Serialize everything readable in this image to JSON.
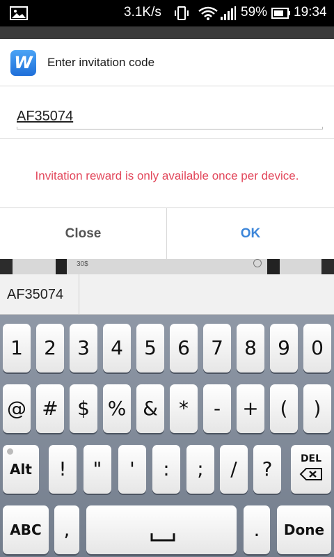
{
  "status_bar": {
    "speed": "3.1K/s",
    "battery_pct": "59%",
    "time": "19:34",
    "icons": [
      "image-icon",
      "vibrate-icon",
      "wifi-icon",
      "signal-icon",
      "battery-icon"
    ]
  },
  "background": {
    "price": "30$"
  },
  "dialog": {
    "title": "Enter invitation code",
    "app_logo_letter": "W",
    "code_value": "AF35074",
    "message": "Invitation reward is only available once per device.",
    "close_label": "Close",
    "ok_label": "OK"
  },
  "suggestion": {
    "word": "AF35074"
  },
  "keyboard": {
    "row1": [
      "1",
      "2",
      "3",
      "4",
      "5",
      "6",
      "7",
      "8",
      "9",
      "0"
    ],
    "row2": [
      "@",
      "#",
      "$",
      "%",
      "&",
      "*",
      "-",
      "+",
      "(",
      ")"
    ],
    "alt_label": "Alt",
    "row3": [
      "!",
      "\"",
      "'",
      ":",
      ";",
      "/",
      "?"
    ],
    "del_label": "DEL",
    "abc_label": "ABC",
    "comma": ",",
    "period": ".",
    "done_label": "Done"
  },
  "colors": {
    "accent": "#3d86d9",
    "message": "#e2475b",
    "keyboard_bg": "#838c9a"
  }
}
